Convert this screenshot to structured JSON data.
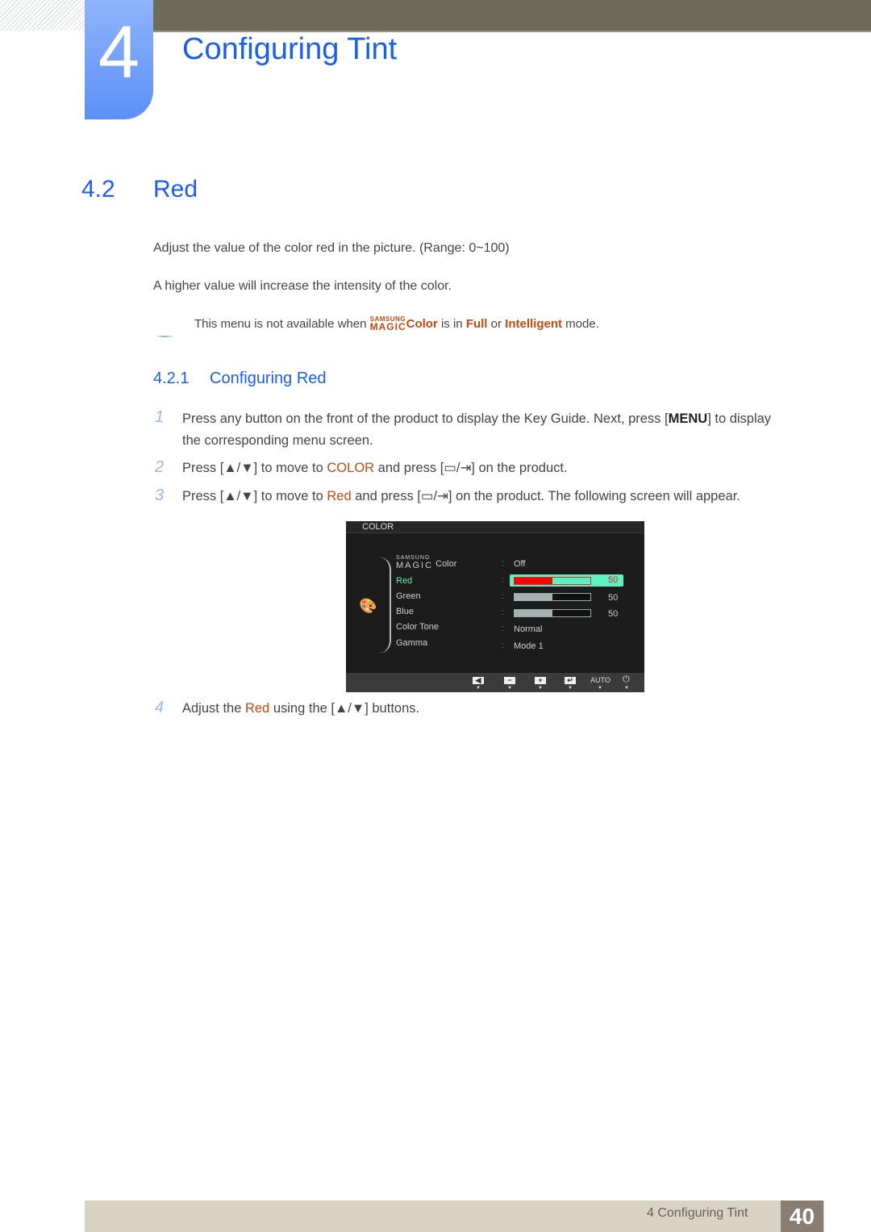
{
  "header": {
    "chapter_number": "4",
    "chapter_title": "Configuring Tint"
  },
  "section": {
    "number": "4.2",
    "title": "Red",
    "paragraphs": [
      "Adjust the value of the color red in the picture. (Range: 0~100)",
      "A higher value will increase the intensity of the color."
    ],
    "note": {
      "prefix": "This menu is not available when ",
      "magic_top": "SAMSUNG",
      "magic_bottom": "MAGIC",
      "color_word": "Color",
      "middle": " is in ",
      "mode1": "Full",
      "or": " or ",
      "mode2": "Intelligent",
      "suffix": " mode."
    }
  },
  "subsection": {
    "number": "4.2.1",
    "title": "Configuring Red",
    "steps": [
      {
        "num": "1",
        "line1_a": "Press any button on the front of the product to display the Key Guide. Next, press [",
        "key": "MENU",
        "line1_b": "] to display",
        "line2": "the corresponding menu screen."
      },
      {
        "num": "2",
        "a": "Press [▲/▼] to move to ",
        "hl": "COLOR",
        "b": " and press [▭/⇥] on the product."
      },
      {
        "num": "3",
        "a": "Press [▲/▼] to move to ",
        "hl": "Red",
        "b": " and press [▭/⇥] on the product. The following screen will appear."
      },
      {
        "num": "4",
        "a": "Adjust the ",
        "hl": "Red",
        "b": " using the [▲/▼] buttons."
      }
    ]
  },
  "osd": {
    "title": "COLOR",
    "items": [
      {
        "label_top": "SAMSUNG",
        "label_main": "MAGIC",
        "label_suffix": "Color",
        "value": "Off"
      },
      {
        "label": "Red",
        "value": 50,
        "selected": true
      },
      {
        "label": "Green",
        "value": 50
      },
      {
        "label": "Blue",
        "value": 50
      },
      {
        "label": "Color Tone",
        "value": "Normal"
      },
      {
        "label": "Gamma",
        "value": "Mode 1"
      }
    ],
    "red_value": "50",
    "green_value": "50",
    "blue_value": "50",
    "red_fraction": 0.5,
    "green_fraction": 0.5,
    "blue_fraction": 0.5,
    "footer_buttons": [
      "◀",
      "−",
      "+",
      "↵",
      "AUTO",
      "⏻"
    ]
  },
  "footer": {
    "chapter_label": "4 Configuring Tint",
    "page": "40"
  }
}
